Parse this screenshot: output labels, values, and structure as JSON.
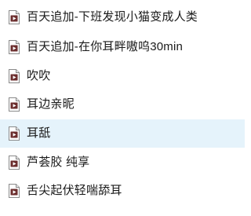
{
  "file_list": {
    "items": [
      {
        "name": "百天追加-下班发现小猫变成人类",
        "icon": "audio-file-icon",
        "selected": false
      },
      {
        "name": "百天追加-在你耳畔嗷呜30min",
        "icon": "audio-file-icon",
        "selected": false
      },
      {
        "name": "吹吹",
        "icon": "audio-file-icon",
        "selected": false
      },
      {
        "name": "耳边亲昵",
        "icon": "audio-file-icon",
        "selected": false
      },
      {
        "name": "耳舐",
        "icon": "audio-file-icon",
        "selected": true
      },
      {
        "name": "芦荟胶 纯享",
        "icon": "audio-file-icon",
        "selected": false
      },
      {
        "name": "舌尖起伏轻喘舔耳",
        "icon": "audio-file-icon",
        "selected": false
      }
    ],
    "selected_color": "#e5f3fb"
  }
}
